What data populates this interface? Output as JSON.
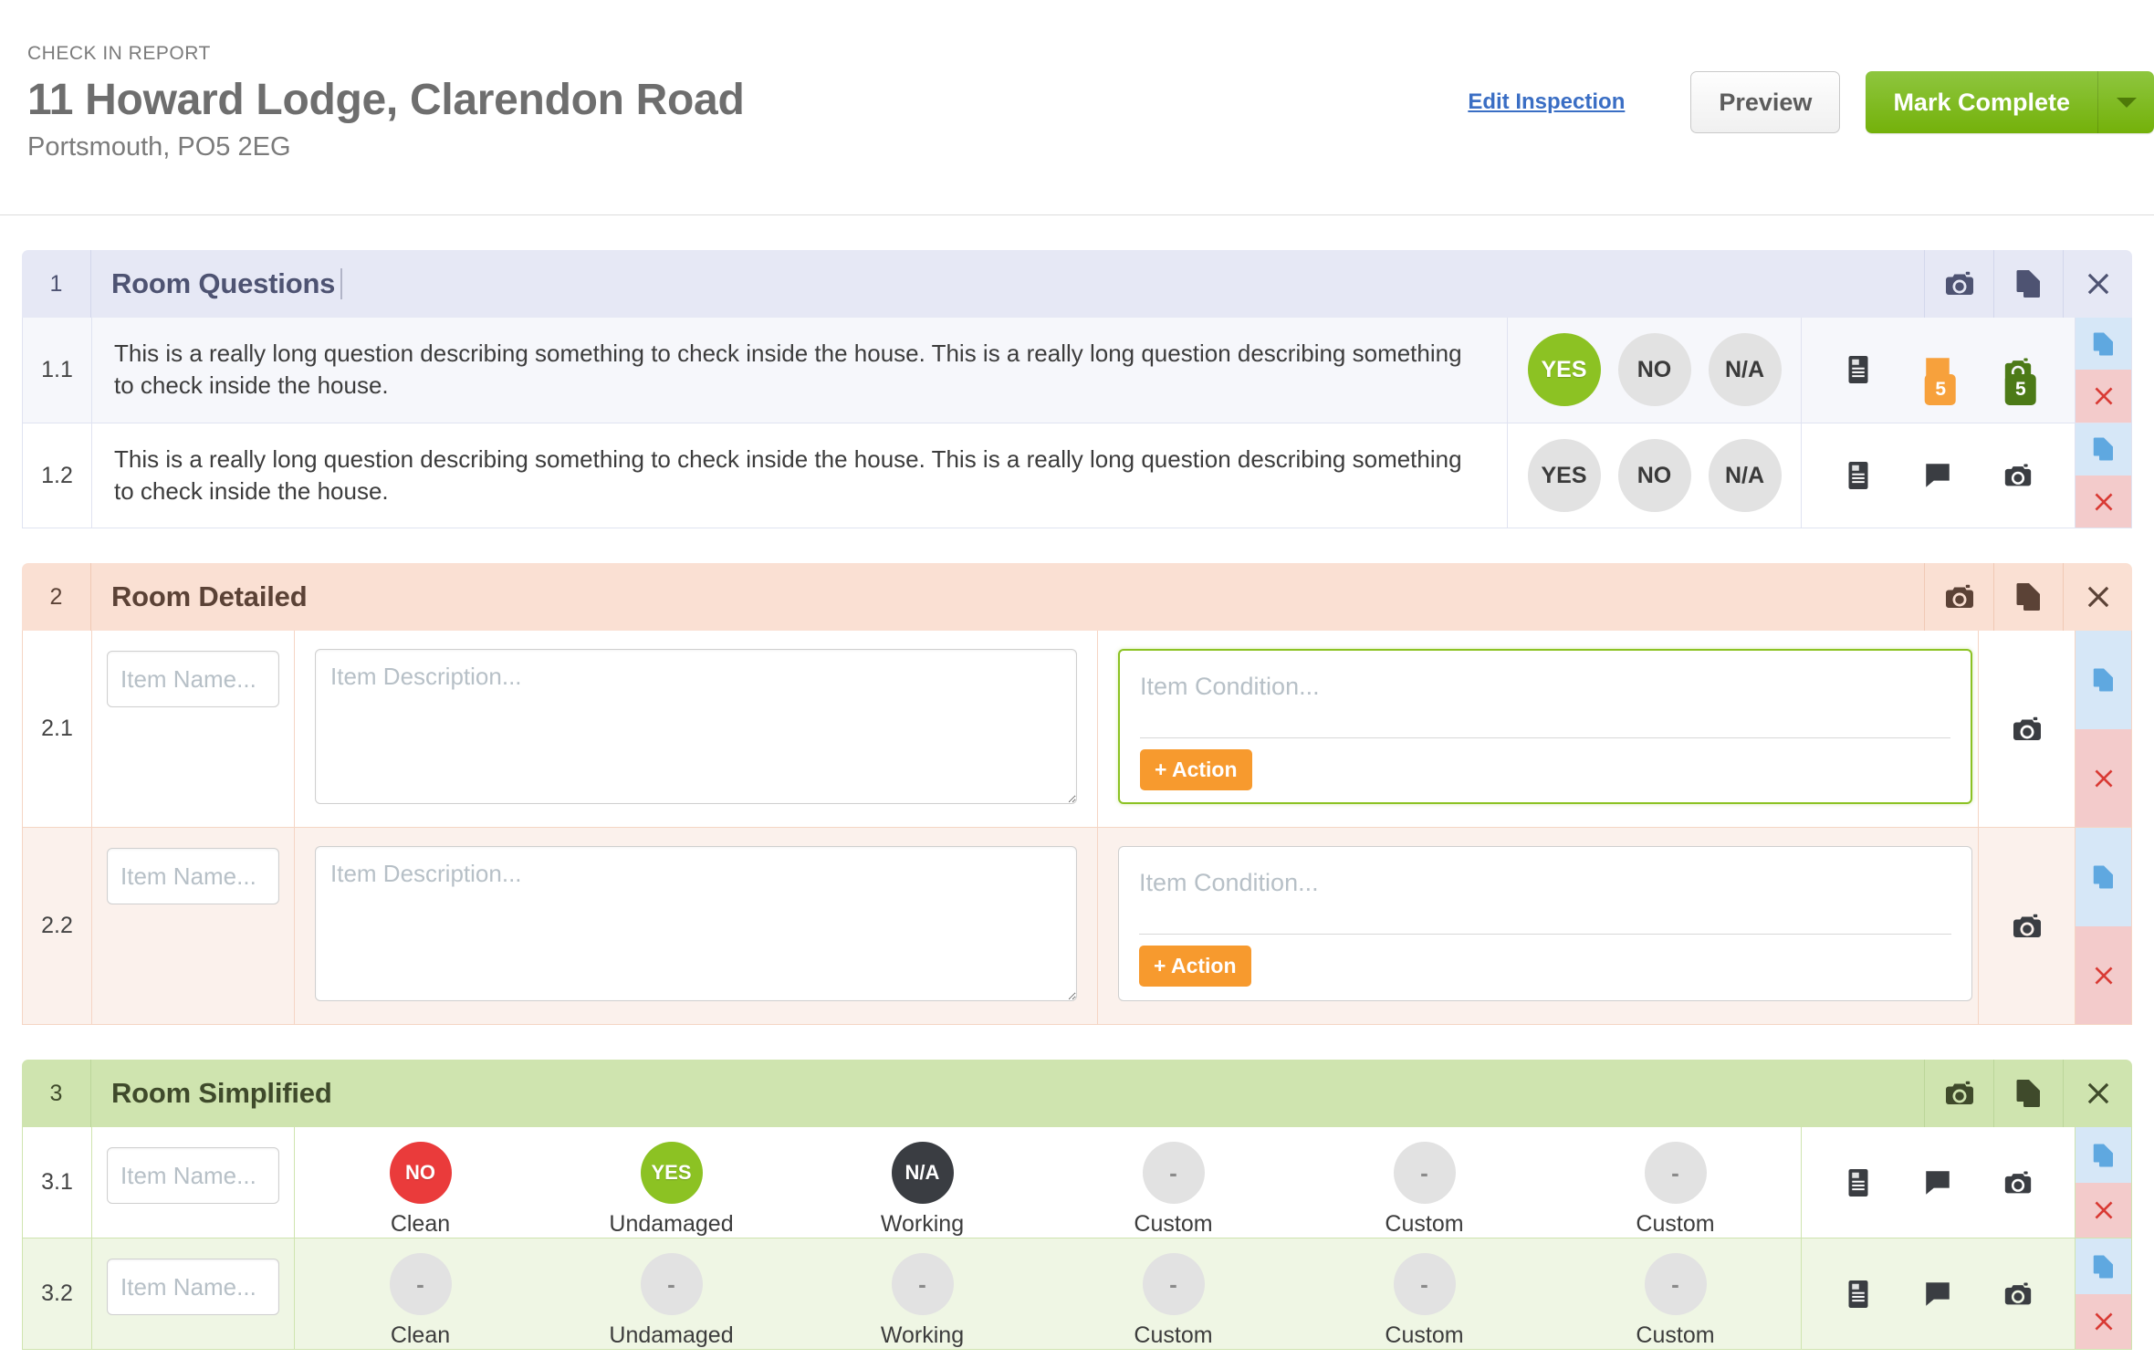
{
  "header": {
    "eyebrow": "CHECK IN REPORT",
    "title": "11 Howard Lodge, Clarendon Road",
    "subtitle": "Portsmouth, PO5 2EG",
    "edit_link": "Edit Inspection",
    "preview_label": "Preview",
    "complete_label": "Mark Complete"
  },
  "sections": [
    {
      "number": "1",
      "title": "Room Questions",
      "theme": "lavender",
      "rows": [
        {
          "number": "1.1",
          "question": "This is a really long question describing something to check inside the house. This is a really long question describing something to check inside the house.",
          "answer": "YES",
          "options": [
            "YES",
            "NO",
            "N/A"
          ],
          "note_badge": null,
          "comment_badge": "5",
          "photo_badge": "5"
        },
        {
          "number": "1.2",
          "question": "This is a really long question describing something to check inside the house. This is a really long question describing something to check inside the house.",
          "answer": null,
          "options": [
            "YES",
            "NO",
            "N/A"
          ],
          "note_badge": null,
          "comment_badge": null,
          "photo_badge": null
        }
      ]
    },
    {
      "number": "2",
      "title": "Room Detailed",
      "theme": "peach",
      "rows": [
        {
          "number": "2.1",
          "name_placeholder": "Item Name...",
          "name_value": "",
          "desc_placeholder": "Item Description...",
          "desc_value": "",
          "condition_placeholder": "Item Condition...",
          "action_label": "+ Action",
          "focused": true
        },
        {
          "number": "2.2",
          "name_placeholder": "Item Name...",
          "name_value": "",
          "desc_placeholder": "Item Description...",
          "desc_value": "",
          "condition_placeholder": "Item Condition...",
          "action_label": "+ Action",
          "focused": false
        }
      ]
    },
    {
      "number": "3",
      "title": "Room Simplified",
      "theme": "green",
      "rows": [
        {
          "number": "3.1",
          "name_placeholder": "Item Name...",
          "name_value": "",
          "ratings": [
            {
              "label": "Clean",
              "value": "NO"
            },
            {
              "label": "Undamaged",
              "value": "YES"
            },
            {
              "label": "Working",
              "value": "N/A"
            },
            {
              "label": "Custom",
              "value": "-"
            },
            {
              "label": "Custom",
              "value": "-"
            },
            {
              "label": "Custom",
              "value": "-"
            }
          ]
        },
        {
          "number": "3.2",
          "name_placeholder": "Item Name...",
          "name_value": "",
          "ratings": [
            {
              "label": "Clean",
              "value": "-"
            },
            {
              "label": "Undamaged",
              "value": "-"
            },
            {
              "label": "Working",
              "value": "-"
            },
            {
              "label": "Custom",
              "value": "-"
            },
            {
              "label": "Custom",
              "value": "-"
            },
            {
              "label": "Custom",
              "value": "-"
            }
          ]
        }
      ]
    }
  ],
  "icons": {
    "camera": "camera-icon",
    "copy": "copy-icon",
    "close": "close-icon",
    "note": "note-icon",
    "comment": "comment-icon",
    "delete": "delete-icon"
  },
  "colors": {
    "accent_green": "#8cc223",
    "accent_red": "#ea3b3b",
    "accent_orange": "#f79a2e",
    "accent_blue": "#5fa8e0",
    "section1": "#e6e8f5",
    "section2": "#fae0d3",
    "section3": "#cfe4af"
  }
}
